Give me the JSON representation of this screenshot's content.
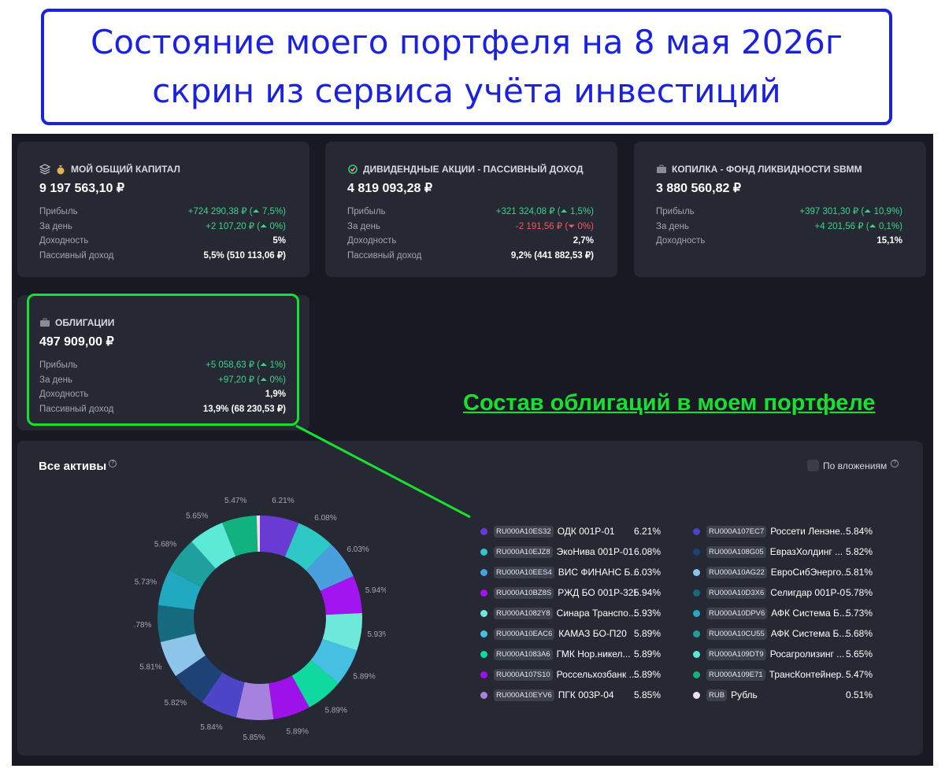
{
  "banner": {
    "line1": "Состояние моего портфеля на 8 мая 2026г",
    "line2": "скрин из сервиса учёта инвестиций"
  },
  "highlight": {
    "caption": "Состав облигаций в моем портфеле"
  },
  "cards": [
    {
      "title": "МОЙ ОБЩИЙ КАПИТАЛ",
      "icon": "money-bag-icon",
      "total": "9 197 563,10 ₽",
      "rows": [
        {
          "label": "Прибыль",
          "value": "+724 290,38 ₽ (⏶ 7,5%)",
          "tone": "up"
        },
        {
          "label": "За день",
          "value": "+2 107,20 ₽ (⏶ 0%)",
          "tone": "up"
        },
        {
          "label": "Доходность",
          "value": "5%",
          "tone": "plain"
        },
        {
          "label": "Пассивный доход",
          "value": "5,5% (510 113,06 ₽)",
          "tone": "plain"
        }
      ]
    },
    {
      "title": "ДИВИДЕНДНЫЕ АКЦИИ - ПАССИВНЫЙ ДОХОД",
      "icon": "check-circle-icon",
      "total": "4 819 093,28 ₽",
      "rows": [
        {
          "label": "Прибыль",
          "value": "+321 324,08 ₽ (⏶ 1,5%)",
          "tone": "up"
        },
        {
          "label": "За день",
          "value": "-2 191,56 ₽ (⏷ 0%)",
          "tone": "down"
        },
        {
          "label": "Доходность",
          "value": "2,7%",
          "tone": "plain"
        },
        {
          "label": "Пассивный доход",
          "value": "9,2% (441 882,53 ₽)",
          "tone": "plain"
        }
      ]
    },
    {
      "title": "КОПИЛКА - ФОНД ЛИКВИДНОСТИ SBMM",
      "icon": "briefcase-icon",
      "total": "3 880 560,82 ₽",
      "rows": [
        {
          "label": "Прибыль",
          "value": "+397 301,30 ₽ (⏶ 10,9%)",
          "tone": "up"
        },
        {
          "label": "За день",
          "value": "+4 201,56 ₽ (⏶ 0,1%)",
          "tone": "up"
        },
        {
          "label": "Доходность",
          "value": "15,1%",
          "tone": "plain"
        }
      ]
    },
    {
      "title": "ОБЛИГАЦИИ",
      "icon": "briefcase-icon",
      "total": "497 909,00 ₽",
      "rows": [
        {
          "label": "Прибыль",
          "value": "+5 058,63 ₽ (⏶ 1%)",
          "tone": "up"
        },
        {
          "label": "За день",
          "value": "+97,20 ₽ (⏶ 0%)",
          "tone": "up"
        },
        {
          "label": "Доходность",
          "value": "1,9%",
          "tone": "plain"
        },
        {
          "label": "Пассивный доход",
          "value": "13,9% (68 230,53 ₽)",
          "tone": "plain"
        }
      ]
    }
  ],
  "assets_panel": {
    "title": "Все активы",
    "help_glyph": "?",
    "toggle_label": "По вложениям"
  },
  "chart_data": {
    "type": "pie",
    "donut": true,
    "slices": [
      {
        "code": "RU000A10ES32",
        "name": "ОДК 001Р-01",
        "pct_label": "6.21%",
        "value": 6.21,
        "color": "#6a3bd4"
      },
      {
        "code": "RU000A10EJZ8",
        "name": "ЭкоНива 001Р-01",
        "pct_label": "6.08%",
        "value": 6.08,
        "color": "#2ec8c6"
      },
      {
        "code": "RU000A10EES4",
        "name": "ВИС ФИНАНС Б...",
        "pct_label": "6.03%",
        "value": 6.03,
        "color": "#4aa0dc"
      },
      {
        "code": "RU000A10BZ8S",
        "name": "РЖД БО 001Р-32R",
        "pct_label": "5.94%",
        "value": 5.94,
        "color": "#a214f0"
      },
      {
        "code": "RU000A1082Y8",
        "name": "Синара Транспо...",
        "pct_label": "5.93%",
        "value": 5.93,
        "color": "#6ee8d8"
      },
      {
        "code": "RU000A10EAC6",
        "name": "КАМАЗ БО-П20",
        "pct_label": "5.89%",
        "value": 5.89,
        "color": "#45bfe2"
      },
      {
        "code": "RU000A1083A6",
        "name": "ГМК Нор.никел...",
        "pct_label": "5.89%",
        "value": 5.89,
        "color": "#10d9a0"
      },
      {
        "code": "RU000A107S10",
        "name": "Россельхозбанк ...",
        "pct_label": "5.89%",
        "value": 5.89,
        "color": "#9c12e8"
      },
      {
        "code": "RU000A10EYV6",
        "name": "ПГК 003Р-04",
        "pct_label": "5.85%",
        "value": 5.85,
        "color": "#a682de"
      },
      {
        "code": "RU000A107EC7",
        "name": "Россети Ленэне...",
        "pct_label": "5.84%",
        "value": 5.84,
        "color": "#4c45c8"
      },
      {
        "code": "RU000A108G05",
        "name": "ЕвразХолдинг ...",
        "pct_label": "5.82%",
        "value": 5.82,
        "color": "#1c4276"
      },
      {
        "code": "RU000A10AG22",
        "name": "ЕвроСибЭнерго...",
        "pct_label": "5.81%",
        "value": 5.81,
        "color": "#8cc4ea"
      },
      {
        "code": "RU000A10D3X6",
        "name": "Селигдар 001Р-07",
        "pct_label": "5.78%",
        "value": 5.78,
        "color": "#166a7e"
      },
      {
        "code": "RU000A10DPV6",
        "name": "АФК Система Б...",
        "pct_label": "5.73%",
        "value": 5.73,
        "color": "#22a9c2"
      },
      {
        "code": "RU000A10CU55",
        "name": "АФК Система Б...",
        "pct_label": "5.68%",
        "value": 5.68,
        "color": "#209f9f"
      },
      {
        "code": "RU000A109DT9",
        "name": "Росагролизинг ...",
        "pct_label": "5.65%",
        "value": 5.65,
        "color": "#5ce9d6"
      },
      {
        "code": "RU000A109E71",
        "name": "ТрансКонтейнер...",
        "pct_label": "5.47%",
        "value": 5.47,
        "color": "#12b27e"
      },
      {
        "code": "RUB",
        "name": "Рубль",
        "pct_label": "0.51%",
        "value": 0.51,
        "color": "#f2ddf6"
      }
    ]
  },
  "colors": {
    "background": "#181922",
    "card": "#262833",
    "positive": "#3fd38a",
    "negative": "#f0595f",
    "highlight": "#19e030",
    "banner": "#1a22e0"
  }
}
